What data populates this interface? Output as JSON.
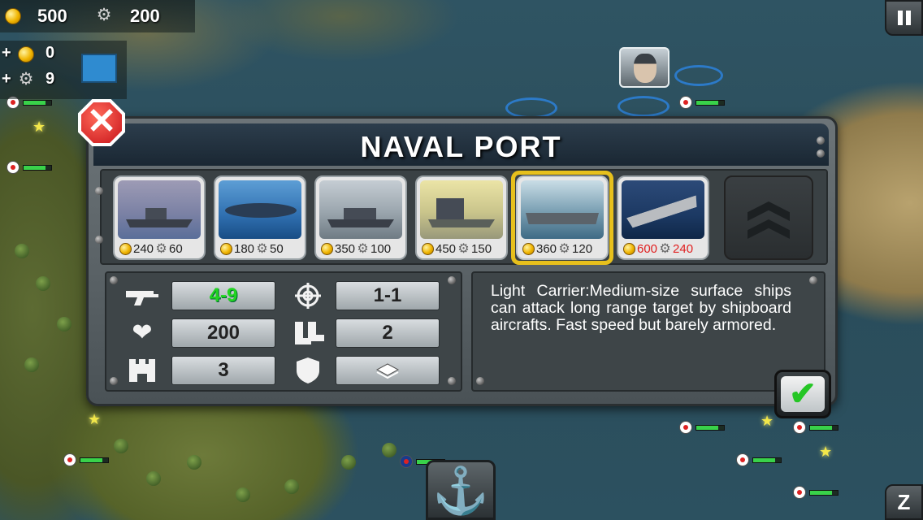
{
  "hud": {
    "gold": "500",
    "parts": "200",
    "gold_income_sign": "+",
    "gold_income": "0",
    "parts_income_sign": "+",
    "parts_income": "9",
    "coin_icon": "coin-icon",
    "gear_icon": "gear-icon"
  },
  "dialog": {
    "title": "NAVAL PORT",
    "close_glyph": "✕",
    "confirm_glyph": "✔",
    "units": [
      {
        "name": "destroyer",
        "gold": "240",
        "parts": "60",
        "affordable": true
      },
      {
        "name": "submarine",
        "gold": "180",
        "parts": "50",
        "affordable": true
      },
      {
        "name": "cruiser",
        "gold": "350",
        "parts": "100",
        "affordable": true
      },
      {
        "name": "battleship",
        "gold": "450",
        "parts": "150",
        "affordable": true
      },
      {
        "name": "light-carrier",
        "gold": "360",
        "parts": "120",
        "affordable": true,
        "selected": true
      },
      {
        "name": "aircraft-carrier",
        "gold": "600",
        "parts": "240",
        "affordable": false
      }
    ],
    "stats": {
      "attack": "4-9",
      "range": "1-1",
      "health": "200",
      "movement": "2",
      "defense_building": "3",
      "armor_icon": "layers-icon"
    },
    "description": "Light Carrier:Medium-size surface ships can attack long range target by shipboard aircrafts. Fast speed but barely armored."
  },
  "colors": {
    "accent_gold": "#e7c01c",
    "attack_green": "#22d422",
    "unaffordable_red": "#e02020"
  },
  "controls": {
    "pause_icon": "pause-icon",
    "anchor_glyph": "⚓",
    "bottom_right_glyph": "Z"
  }
}
